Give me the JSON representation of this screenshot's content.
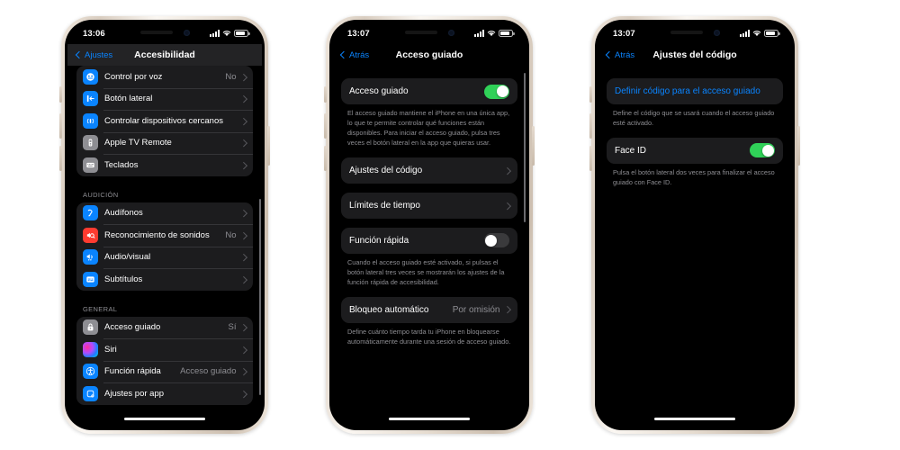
{
  "meta": {
    "page_background": "#ffffff",
    "accent_blue": "#0a84ff",
    "toggle_on_green": "#30d158",
    "cell_background": "#1c1c1e",
    "secondary_text": "#8e8e93"
  },
  "phones": [
    {
      "id": "phone-accessibility",
      "status_bar": {
        "time": "13:06",
        "signal": "signal-bars-icon",
        "wifi": "wifi-icon",
        "battery": "battery-icon"
      },
      "nav": {
        "back_label": "Ajustes",
        "title": "Accesibilidad",
        "back_icon": "chevron-left-icon"
      },
      "sections": [
        {
          "header": "",
          "rows": [
            {
              "icon": "voice-control-icon",
              "icon_color": "blue",
              "glyph": "◉",
              "label": "Control por voz",
              "value": "No",
              "chevron": true
            },
            {
              "icon": "side-button-icon",
              "icon_color": "blue",
              "glyph": "⇥",
              "label": "Botón lateral",
              "value": "",
              "chevron": true
            },
            {
              "icon": "nearby-devices-icon",
              "icon_color": "blue",
              "glyph": "((o))",
              "label": "Controlar dispositivos cercanos",
              "value": "",
              "chevron": true
            },
            {
              "icon": "apple-tv-remote-icon",
              "icon_color": "gray",
              "glyph": "▯",
              "label": "Apple TV Remote",
              "value": "",
              "chevron": true
            },
            {
              "icon": "keyboards-icon",
              "icon_color": "gray",
              "glyph": "⌨",
              "label": "Teclados",
              "value": "",
              "chevron": true
            }
          ]
        },
        {
          "header": "AUDICIÓN",
          "rows": [
            {
              "icon": "hearing-devices-icon",
              "icon_color": "blue",
              "glyph": "ᗤ",
              "label": "Audífonos",
              "value": "",
              "chevron": true
            },
            {
              "icon": "sound-recognition-icon",
              "icon_color": "red",
              "glyph": "◖",
              "label": "Reconocimiento de sonidos",
              "value": "No",
              "chevron": true
            },
            {
              "icon": "audio-visual-icon",
              "icon_color": "blue",
              "glyph": "◀",
              "label": "Audio/visual",
              "value": "",
              "chevron": true
            },
            {
              "icon": "subtitles-icon",
              "icon_color": "blue",
              "glyph": "▭",
              "label": "Subtítulos",
              "value": "",
              "chevron": true
            }
          ]
        },
        {
          "header": "GENERAL",
          "rows": [
            {
              "icon": "guided-access-lock-icon",
              "icon_color": "gray",
              "glyph": "🔒",
              "label": "Acceso guiado",
              "value": "Sí",
              "chevron": true
            },
            {
              "icon": "siri-icon",
              "icon_color": "siri",
              "glyph": "",
              "label": "Siri",
              "value": "",
              "chevron": true
            },
            {
              "icon": "accessibility-shortcut-icon",
              "icon_color": "blue",
              "glyph": "◉",
              "label": "Función rápida",
              "value": "Acceso guiado",
              "chevron": true
            },
            {
              "icon": "per-app-settings-icon",
              "icon_color": "blue",
              "glyph": "▣",
              "label": "Ajustes por app",
              "value": "",
              "chevron": true
            }
          ]
        }
      ]
    },
    {
      "id": "phone-guided-access",
      "status_bar": {
        "time": "13:07",
        "signal": "signal-bars-icon",
        "wifi": "wifi-icon",
        "battery": "battery-icon"
      },
      "nav": {
        "back_label": "Atrás",
        "title": "Acceso guiado",
        "back_icon": "chevron-left-icon"
      },
      "blocks": [
        {
          "type": "toggle",
          "name": "guided-access-toggle-row",
          "label": "Acceso guiado",
          "state": "on"
        },
        {
          "type": "footnote",
          "name": "guided-access-description",
          "text": "El acceso guiado mantiene el iPhone en una única app, lo que te permite controlar qué funciones están disponibles. Para iniciar el acceso guiado, pulsa tres veces el botón lateral en la app que quieras usar."
        },
        {
          "type": "link",
          "name": "passcode-settings-row",
          "label": "Ajustes del código",
          "value": "",
          "chevron": true
        },
        {
          "type": "link",
          "name": "time-limits-row",
          "label": "Límites de tiempo",
          "value": "",
          "chevron": true
        },
        {
          "type": "toggle",
          "name": "accessibility-shortcut-toggle-row",
          "label": "Función rápida",
          "state": "off"
        },
        {
          "type": "footnote",
          "name": "accessibility-shortcut-description",
          "text": "Cuando el acceso guiado esté activado, si pulsas el botón lateral tres veces se mostrarán los ajustes de la función rápida de accesibilidad."
        },
        {
          "type": "link",
          "name": "auto-lock-row",
          "label": "Bloqueo automático",
          "value": "Por omisión",
          "chevron": true
        },
        {
          "type": "footnote",
          "name": "auto-lock-description",
          "text": "Define cuánto tiempo tarda tu iPhone en bloquearse automáticamente durante una sesión de acceso guiado."
        }
      ]
    },
    {
      "id": "phone-passcode-settings",
      "status_bar": {
        "time": "13:07",
        "signal": "signal-bars-icon",
        "wifi": "wifi-icon",
        "battery": "battery-icon"
      },
      "nav": {
        "back_label": "Atrás",
        "title": "Ajustes del código",
        "back_icon": "chevron-left-icon"
      },
      "blocks": [
        {
          "type": "action",
          "name": "set-guided-access-passcode-button",
          "label": "Definir código para el acceso guiado"
        },
        {
          "type": "footnote",
          "name": "set-passcode-description",
          "text": "Define el código que se usará cuando el acceso guiado esté activado."
        },
        {
          "type": "toggle",
          "name": "face-id-toggle-row",
          "label": "Face ID",
          "state": "on"
        },
        {
          "type": "footnote",
          "name": "face-id-description",
          "text": "Pulsa el botón lateral dos veces para finalizar el acceso guiado con Face ID."
        }
      ]
    }
  ]
}
